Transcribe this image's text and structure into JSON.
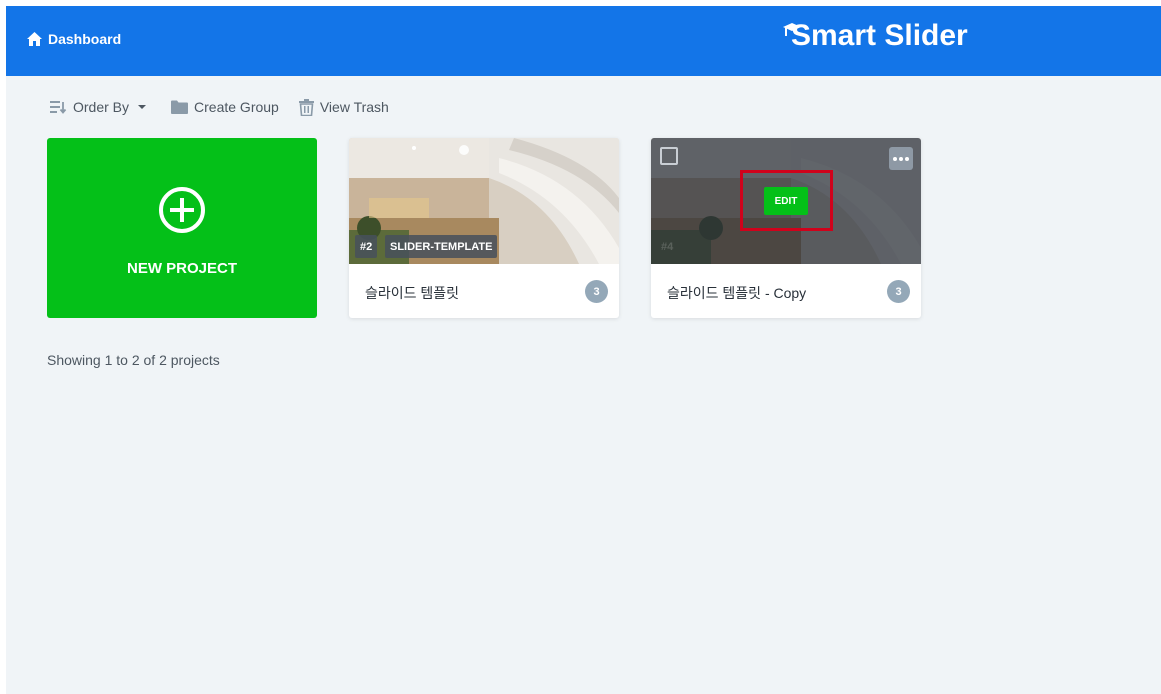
{
  "colors": {
    "accent": "#1375e8",
    "new_project_green": "#04c018",
    "badge": "#94a8b8",
    "highlight": "#d0021b"
  },
  "header": {
    "dashboard_label": "Dashboard",
    "dashboard_icon": "home-icon",
    "brand": "Smart Slider",
    "brand_icon": "graduation-cap-icon"
  },
  "toolbar": {
    "order_by": {
      "label": "Order By",
      "icon": "sort-list-icon",
      "caret_icon": "caret-down-icon"
    },
    "create_group": {
      "label": "Create Group",
      "icon": "folder-icon"
    },
    "view_trash": {
      "label": "View Trash",
      "icon": "trash-icon"
    }
  },
  "new_project": {
    "label": "NEW PROJECT",
    "icon": "plus-circle-icon"
  },
  "projects": [
    {
      "id_label": "#2",
      "type_label": "SLIDER-TEMPLATE",
      "title": "슬라이드 템플릿",
      "slide_count": "3"
    },
    {
      "id_label": "#4",
      "title": "슬라이드 템플릿 - Copy",
      "slide_count": "3",
      "edit_label": "EDIT",
      "more_icon": "more-dots-icon",
      "select_icon": "checkbox-icon"
    }
  ],
  "footer": {
    "showing_text": "Showing 1 to 2 of 2 projects"
  }
}
